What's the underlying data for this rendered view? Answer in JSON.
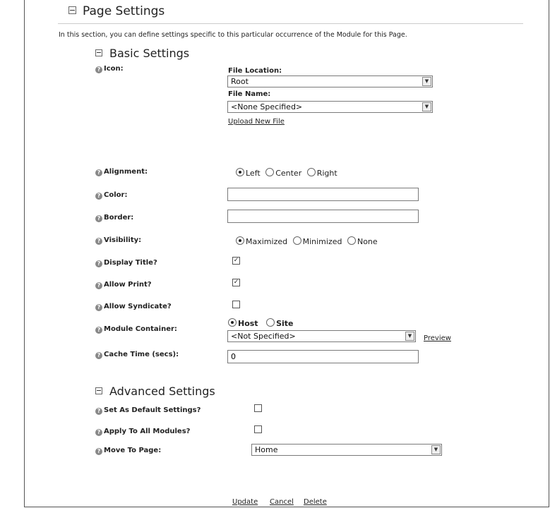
{
  "page_settings": {
    "title": "Page Settings",
    "intro": "In this section, you can define settings specific to this particular occurrence of the Module for this Page."
  },
  "basic": {
    "title": "Basic Settings",
    "icon_label": "Icon:",
    "file_location_label": "File Location:",
    "file_location_value": "Root",
    "file_name_label": "File Name:",
    "file_name_value": "<None Specified>",
    "upload_link": "Upload New File",
    "alignment_label": "Alignment:",
    "alignment_options": [
      "Left",
      "Center",
      "Right"
    ],
    "alignment_selected": "Left",
    "color_label": "Color:",
    "color_value": "",
    "border_label": "Border:",
    "border_value": "",
    "visibility_label": "Visibility:",
    "visibility_options": [
      "Maximized",
      "Minimized",
      "None"
    ],
    "visibility_selected": "Maximized",
    "display_title_label": "Display Title?",
    "display_title_checked": true,
    "allow_print_label": "Allow Print?",
    "allow_print_checked": true,
    "allow_syndicate_label": "Allow Syndicate?",
    "allow_syndicate_checked": false,
    "module_container_label": "Module Container:",
    "container_options": [
      "Host",
      "Site"
    ],
    "container_selected": "Host",
    "container_value": "<Not Specified>",
    "preview_link": "Preview",
    "cache_time_label": "Cache Time (secs):",
    "cache_time_value": "0"
  },
  "advanced": {
    "title": "Advanced Settings",
    "default_settings_label": "Set As Default Settings?",
    "default_settings_checked": false,
    "apply_all_label": "Apply To All Modules?",
    "apply_all_checked": false,
    "move_to_page_label": "Move To Page:",
    "move_to_page_value": "Home"
  },
  "actions": {
    "update": "Update",
    "cancel": "Cancel",
    "delete": "Delete"
  },
  "icons": {
    "help": "help-icon",
    "collapse": "collapse-icon",
    "dropdown": "dropdown-arrow-icon"
  }
}
